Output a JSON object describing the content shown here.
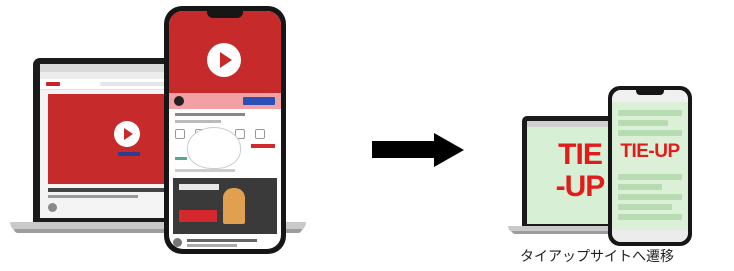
{
  "left_device": {
    "description_name": "video-site-laptop",
    "accent_color": "#c62a2a"
  },
  "right_device": {
    "tie_up_label_laptop": "TIE\n-UP",
    "tie_up_label_phone": "TIE-UP",
    "accent_color": "#e21b1b",
    "background_color": "#d7efd4"
  },
  "caption": "タイアップサイトへ遷移",
  "icons": [
    "play-icon",
    "right-arrow-icon"
  ]
}
